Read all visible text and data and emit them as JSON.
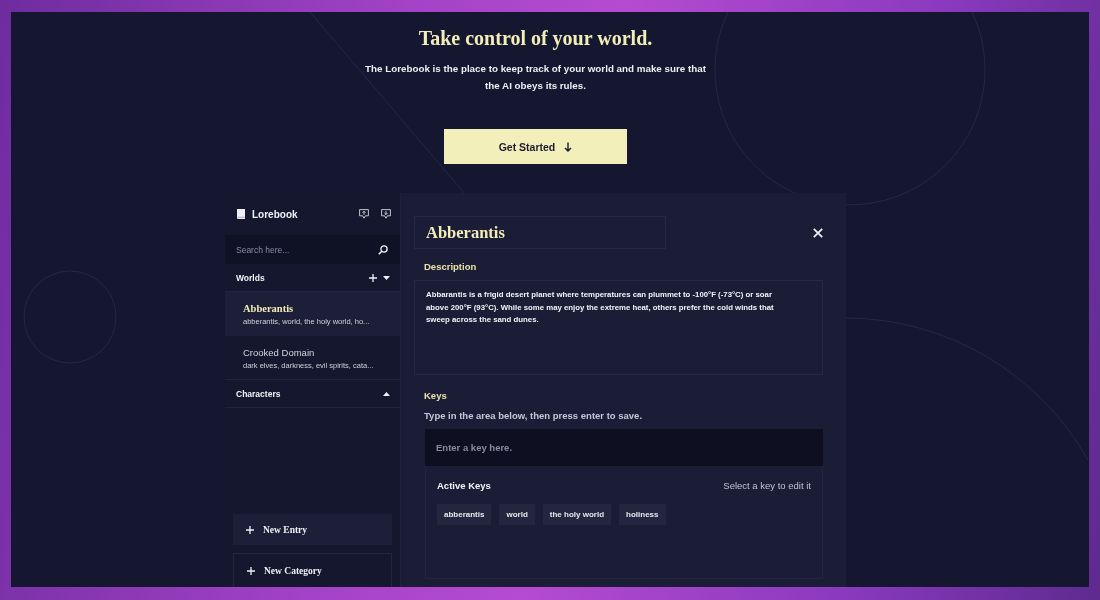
{
  "hero": {
    "title": "Take control of your world.",
    "subtitle": "The Lorebook is the place to keep track of your world and make sure that the AI obeys its rules.",
    "button": "Get Started"
  },
  "sidebar": {
    "title": "Lorebook",
    "search": {
      "placeholder": "Search here..."
    },
    "categories": [
      {
        "name": "Worlds",
        "expanded": true,
        "entries": [
          {
            "title": "Abberantis",
            "keys": "abberantis, world, the holy world, ho...",
            "selected": true
          },
          {
            "title": "Crooked Domain",
            "keys": "dark elves, darkness, evil spirits, cata...",
            "selected": false
          }
        ]
      },
      {
        "name": "Characters",
        "expanded": false
      }
    ],
    "buttons": [
      {
        "label": "New Entry",
        "kind": "filled"
      },
      {
        "label": "New Category",
        "kind": "outlined"
      }
    ]
  },
  "entry": {
    "title": "Abberantis",
    "description_label": "Description",
    "description": "Abbarantis is a frigid desert planet where temperatures can plummet to -100°F (-73°C) or soar above 200°F (93°C). While some may enjoy the extreme heat, others prefer the cold winds that sweep across the sand dunes.",
    "keys_label": "Keys",
    "keys_hint": "Type in the area below, then press enter to save.",
    "key_input": {
      "placeholder": "Enter a key here."
    },
    "active_keys_label": "Active Keys",
    "active_keys_hint": "Select a key to edit it",
    "active_keys": [
      "abberantis",
      "world",
      "the holy world",
      "holiness"
    ]
  }
}
